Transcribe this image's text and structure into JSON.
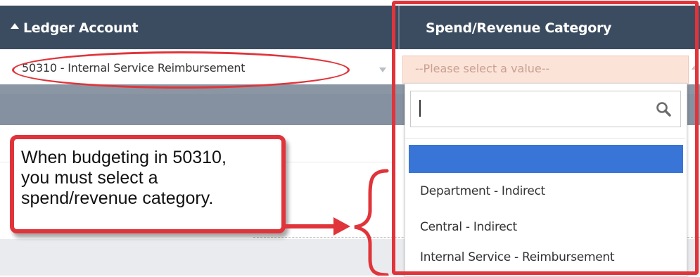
{
  "table": {
    "headers": {
      "ledger_account": "Ledger Account",
      "spend_revenue_category": "Spend/Revenue Category"
    },
    "ledger_account_value": "50310 - Internal Service Reimbursement",
    "spend_revenue_placeholder": "--Please select a value--"
  },
  "dropdown": {
    "search_value": "",
    "options": [
      {
        "label": ""
      },
      {
        "label": "Department - Indirect"
      },
      {
        "label": "Central - Indirect"
      },
      {
        "label": "Internal Service - Reimbursement"
      }
    ],
    "highlighted_index": 0
  },
  "annotation": {
    "callout_lines": [
      "When budgeting in 50310,",
      "you must select a",
      "spend/revenue category."
    ]
  },
  "colors": {
    "header_bg": "#3c4c60",
    "annotation_red": "#e0343a",
    "highlight_blue": "#3875d7",
    "required_field_bg": "#fbe3d8"
  },
  "icons": [
    "sort-ascending-icon",
    "dropdown-arrow-icon",
    "search-icon",
    "curly-brace-icon",
    "arrow-icon"
  ]
}
